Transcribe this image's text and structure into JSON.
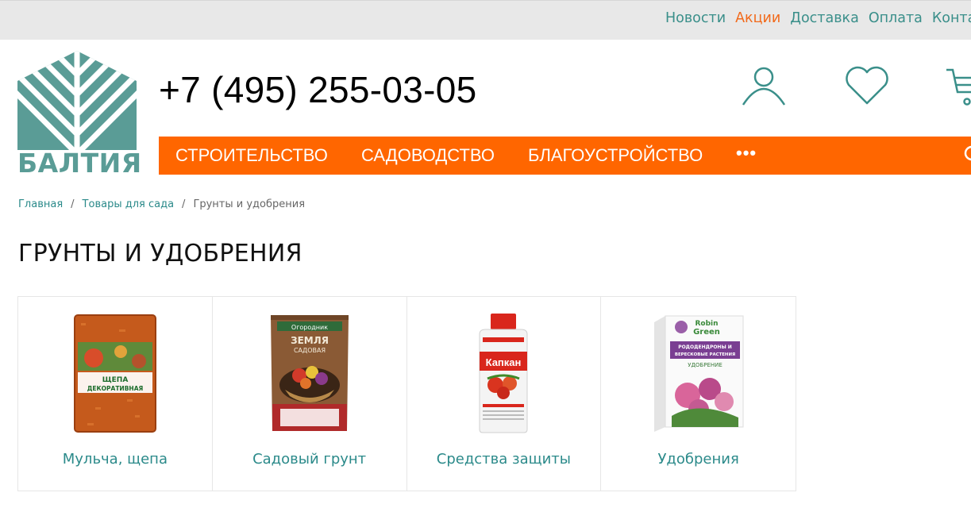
{
  "topnav": {
    "items": [
      {
        "label": "Новости"
      },
      {
        "label": "Акции"
      },
      {
        "label": "Доставка"
      },
      {
        "label": "Оплата"
      },
      {
        "label": "Контакты"
      }
    ]
  },
  "header": {
    "logo_text": "БАЛТИЯ",
    "phone": "+7 (495) 255-03-05",
    "icons": [
      "user-icon",
      "heart-icon",
      "cart-icon"
    ]
  },
  "mainnav": {
    "items": [
      {
        "label": "СТРОИТЕЛЬСТВО"
      },
      {
        "label": "САДОВОДСТВО"
      },
      {
        "label": "БЛАГОУСТРОЙСТВО"
      }
    ],
    "more": "•••"
  },
  "breadcrumb": {
    "home": "Главная",
    "sep": "/",
    "parent": "Товары для сада",
    "current": "Грунты и удобрения"
  },
  "page_title": "ГРУНТЫ И УДОБРЕНИЯ",
  "categories": [
    {
      "label": "Мульча, щепа",
      "product_text": [
        "ЩЕПА",
        "ДЕКОРАТИВНАЯ"
      ]
    },
    {
      "label": "Садовый грунт",
      "product_text": [
        "Огородник",
        "ЗЕМЛЯ",
        "САДОВАЯ"
      ]
    },
    {
      "label": "Средства защиты",
      "product_text": [
        "Капкан"
      ]
    },
    {
      "label": "Удобрения",
      "product_text": [
        "Robin",
        "Green",
        "РОДОДЕНДРОНЫ И",
        "ВЕРЕСКОВЫЕ РАСТЕНИЯ",
        "УДОБРЕНИЕ"
      ]
    }
  ],
  "colors": {
    "teal": "#3a8f8a",
    "orange": "#ff6600",
    "accent_link": "#f26a1b",
    "topbar_bg": "#e8e8e8"
  }
}
